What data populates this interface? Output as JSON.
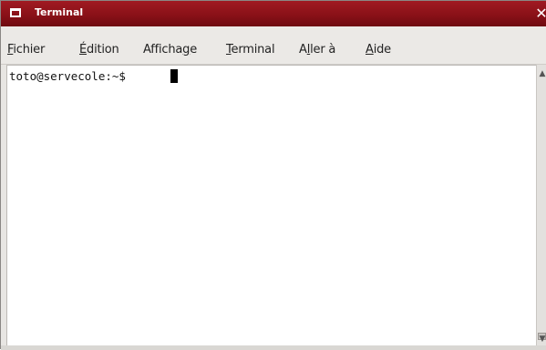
{
  "window": {
    "title": "Terminal",
    "close_glyph": "✕",
    "title_icon": "window-icon",
    "colors": {
      "titlebar": "#8a1118",
      "title_text": "#ffffff",
      "terminal_bg": "#ffffff"
    }
  },
  "menubar": {
    "items": [
      {
        "mnemonic": "F",
        "rest": "ichier"
      },
      {
        "mnemonic": "É",
        "rest": "dition"
      },
      {
        "pre": "Afficha",
        "mnemonic": "g",
        "rest": "e"
      },
      {
        "mnemonic": "T",
        "rest": "erminal"
      },
      {
        "pre": "A",
        "mnemonic": "l",
        "rest": "ler à"
      },
      {
        "mnemonic": "A",
        "rest": "ide"
      }
    ]
  },
  "terminal": {
    "prompt": "toto@servecole:~$"
  },
  "scrollbar": {
    "up_icon": "arrow-up-icon",
    "down_icon": "arrow-down-icon",
    "up_glyph": "▲",
    "down_glyph": "▼"
  }
}
